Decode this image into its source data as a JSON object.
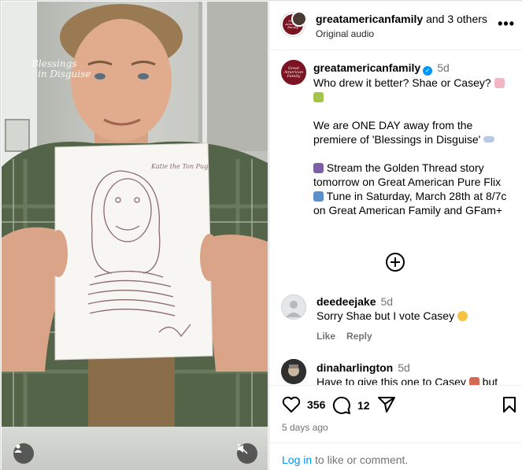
{
  "video": {
    "watermark_line1": "Blessings",
    "watermark_line2": "in Disguise",
    "user_icon": "user-icon",
    "mute_icon": "speaker-muted-icon",
    "drawing_note": "Katie the Ton Pug"
  },
  "header": {
    "account": "greatamericanfamily",
    "others_text": " and 3 others",
    "audio": "Original audio",
    "more_icon": "more-horizontal-icon",
    "more_glyph": "•••"
  },
  "caption": {
    "username": "greatamericanfamily",
    "age": "5d",
    "line1": "Who drew it better? Shae or Casey?",
    "line2": "We are ONE DAY away from the premiere of 'Blessings in Disguise'",
    "line3": "Stream the Golden Thread story tomorrow on Great American Pure Flix",
    "line4": "Tune in Saturday, March 28th at 8/7c on Great American Family and GFam+",
    "brand_avatar_text": "Great American Family"
  },
  "load_more_icon": "plus-circle-icon",
  "comments": [
    {
      "username": "deedeejake",
      "age": "5d",
      "text": "Sorry Shae but I vote Casey",
      "like": "Like",
      "reply": "Reply"
    },
    {
      "username": "dinaharlington",
      "age": "5d",
      "text": "Have to give this one to Casey",
      "trail": " but"
    }
  ],
  "actions": {
    "like_count": "356",
    "comment_count": "12",
    "date": "5 days ago",
    "login_link": "Log in",
    "login_rest": " to like or comment."
  },
  "colors": {
    "brand": "#7a1322",
    "link": "#0095f6",
    "muted": "#737373"
  }
}
